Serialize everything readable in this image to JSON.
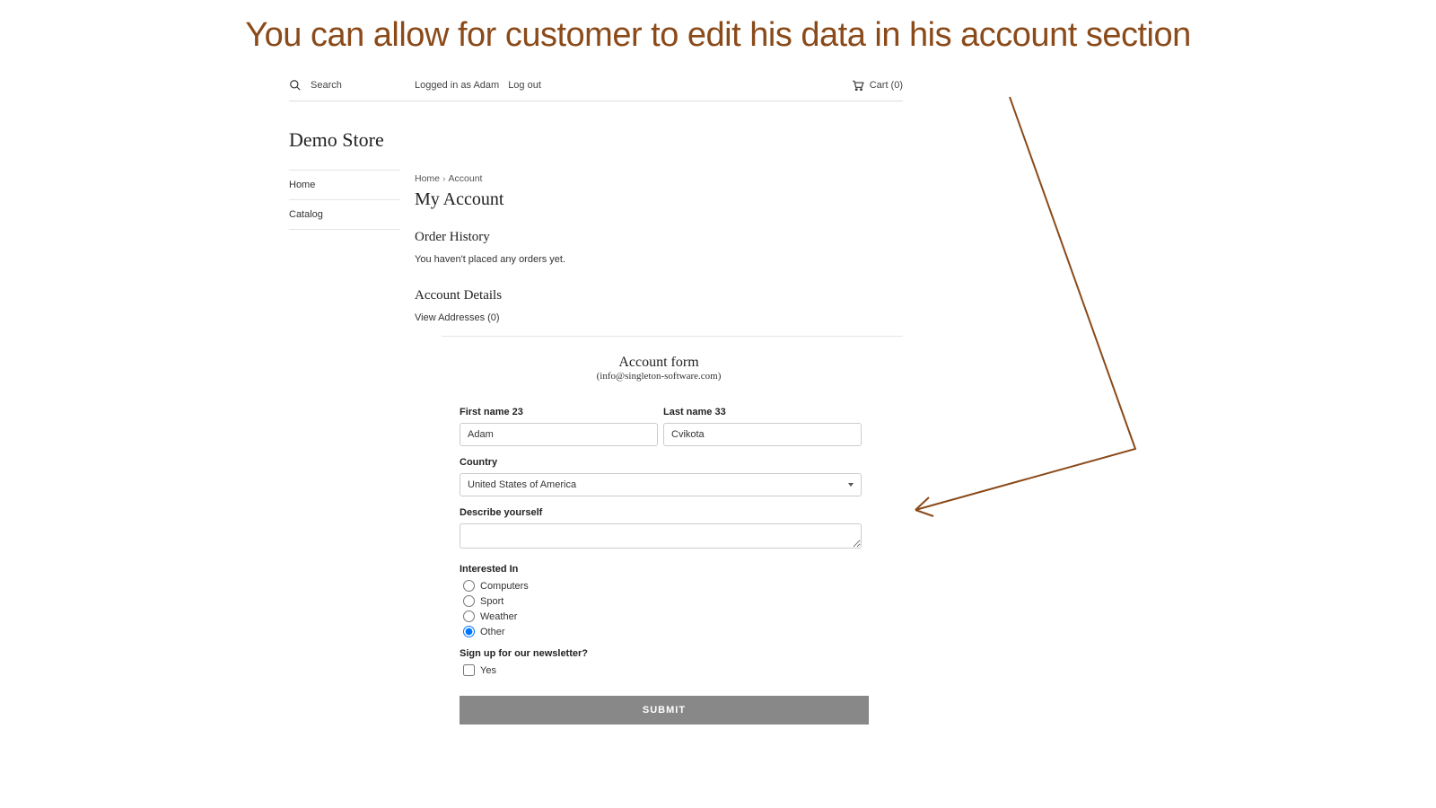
{
  "headline": "You can allow for customer to edit his data in his account section",
  "topbar": {
    "search_label": "Search",
    "logged_in_as": "Logged in as Adam",
    "logout": "Log out",
    "cart": "Cart (0)"
  },
  "store_title": "Demo Store",
  "sidebar": {
    "items": [
      "Home",
      "Catalog"
    ]
  },
  "breadcrumb": {
    "home": "Home",
    "current": "Account"
  },
  "page": {
    "title": "My Account",
    "order_history_heading": "Order History",
    "order_history_empty": "You haven't placed any orders yet.",
    "account_details_heading": "Account Details",
    "view_addresses": "View Addresses (0)"
  },
  "form": {
    "title": "Account form",
    "subtitle": "(info@singleton-software.com)",
    "first_name_label": "First name 23",
    "first_name_value": "Adam",
    "last_name_label": "Last name 33",
    "last_name_value": "Cvikota",
    "country_label": "Country",
    "country_value": "United States of America",
    "describe_label": "Describe yourself",
    "describe_value": "",
    "interested_label": "Interested In",
    "interested_options": [
      "Computers",
      "Sport",
      "Weather",
      "Other"
    ],
    "interested_selected": "Other",
    "newsletter_label": "Sign up for our newsletter?",
    "newsletter_option": "Yes",
    "submit_label": "SUBMIT"
  }
}
